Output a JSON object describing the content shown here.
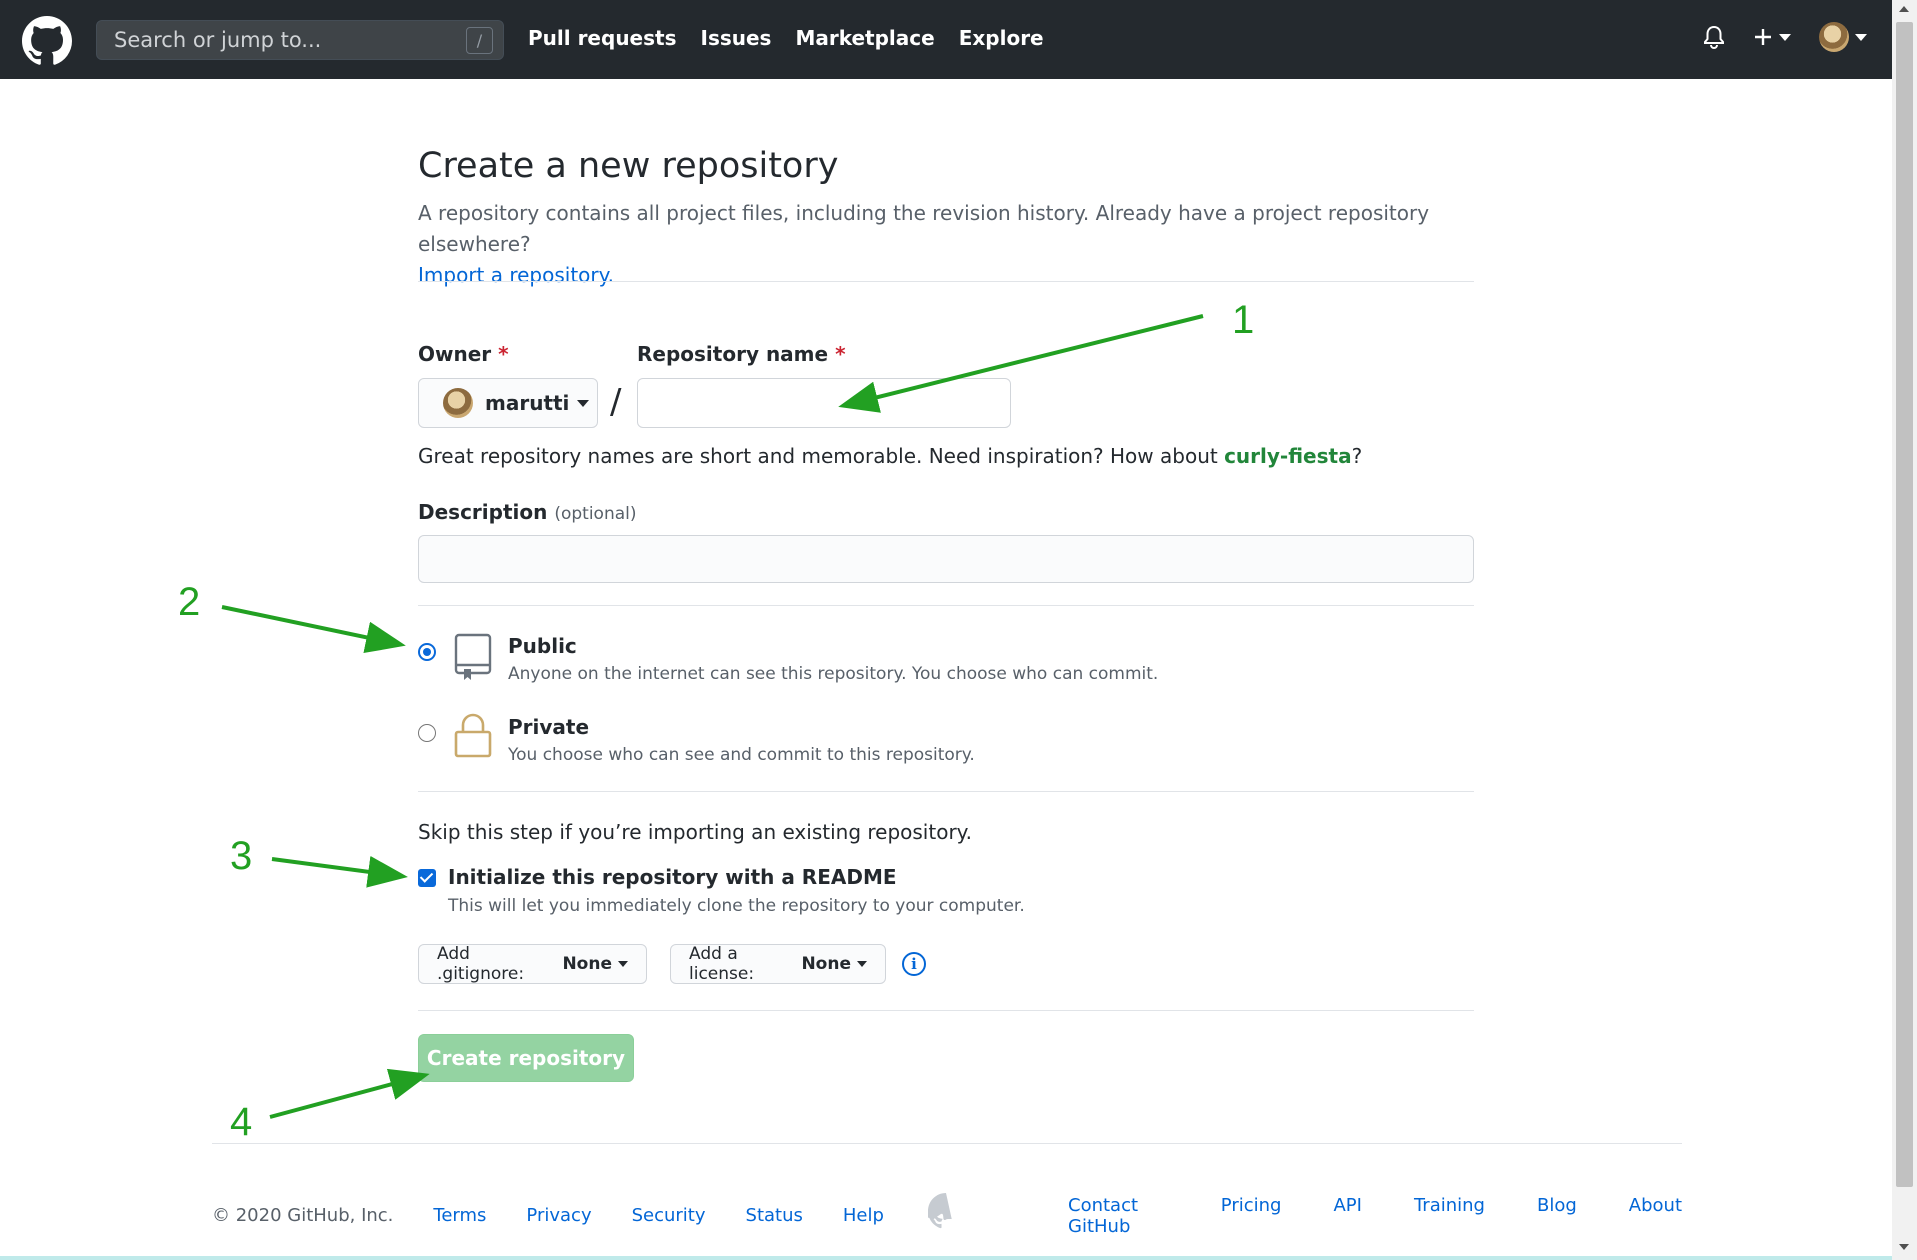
{
  "header": {
    "search_placeholder": "Search or jump to...",
    "search_shortcut": "/",
    "nav": [
      "Pull requests",
      "Issues",
      "Marketplace",
      "Explore"
    ]
  },
  "page": {
    "title": "Create a new repository",
    "subtitle": "A repository contains all project files, including the revision history. Already have a project repository elsewhere?",
    "import_link": "Import a repository."
  },
  "form": {
    "owner_label": "Owner",
    "required_mark": "*",
    "owner_value": "marutti",
    "slash": "/",
    "repo_name_label": "Repository name",
    "hint_prefix": "Great repository names are short and memorable. Need inspiration? How about ",
    "hint_suggestion": "curly-fiesta",
    "hint_suffix": "?",
    "description_label": "Description",
    "description_optional": "(optional)",
    "visibility": {
      "public_title": "Public",
      "public_desc": "Anyone on the internet can see this repository. You choose who can commit.",
      "private_title": "Private",
      "private_desc": "You choose who can see and commit to this repository.",
      "selected": "public"
    },
    "skip_text": "Skip this step if you’re importing an existing repository.",
    "readme_label": "Initialize this repository with a README",
    "readme_desc": "This will let you immediately clone the repository to your computer.",
    "readme_checked": true,
    "gitignore_label": "Add .gitignore:",
    "gitignore_value": "None",
    "license_label": "Add a license:",
    "license_value": "None",
    "info_glyph": "i",
    "create_button": "Create repository"
  },
  "annotations": [
    "1",
    "2",
    "3",
    "4"
  ],
  "footer": {
    "copyright": "© 2020 GitHub, Inc.",
    "left_links": [
      "Terms",
      "Privacy",
      "Security",
      "Status",
      "Help"
    ],
    "right_links": [
      "Contact GitHub",
      "Pricing",
      "API",
      "Training",
      "Blog",
      "About"
    ]
  },
  "colors": {
    "header_bg": "#24292e",
    "link": "#0366d6",
    "accent_green": "#22a022",
    "create_btn_disabled": "#94d3a2"
  }
}
